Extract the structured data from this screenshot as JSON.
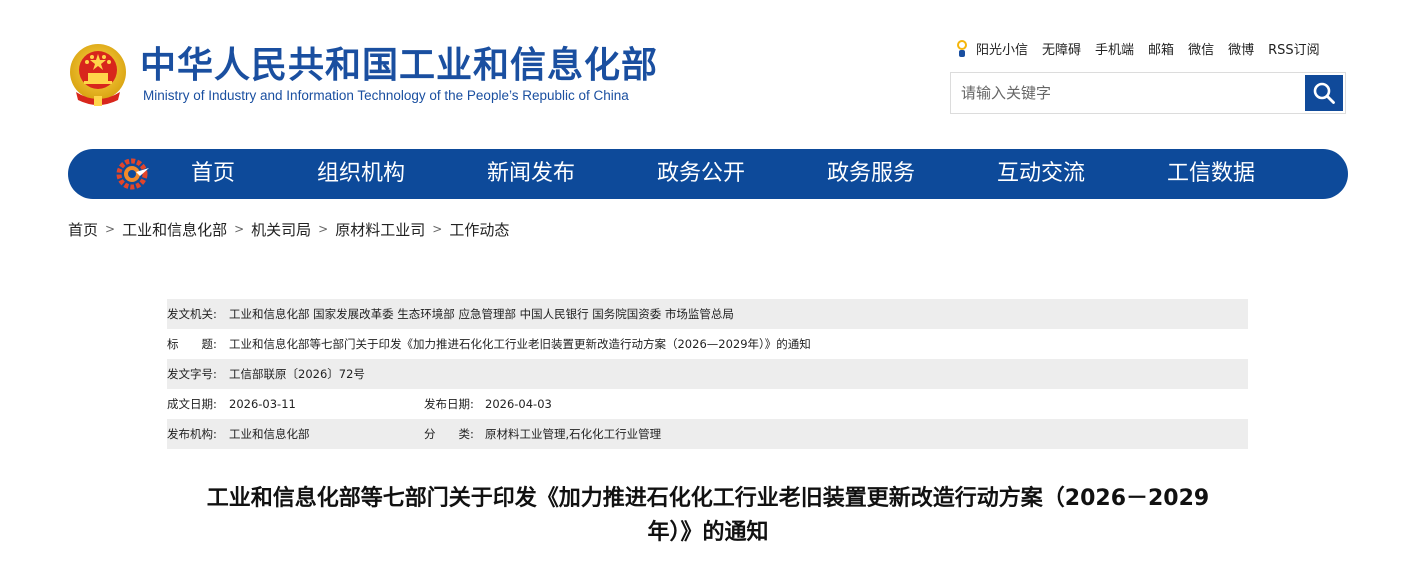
{
  "header": {
    "title": "中华人民共和国工业和信息化部",
    "subtitle": "Ministry of Industry and Information Technology of the People’s Republic of China",
    "emblem_icon": "national-emblem-icon",
    "brand_color": "#1a4fa0",
    "top_links": [
      "阳光小信",
      "无障碍",
      "手机端",
      "邮箱",
      "微信",
      "微博",
      "RSS订阅"
    ],
    "search": {
      "placeholder": "请输入关键字",
      "value": "",
      "button_icon": "search-icon"
    }
  },
  "nav": {
    "bg_color": "#0d4a9a",
    "logo_icon": "ministry-gear-logo-icon",
    "items": [
      "首页",
      "组织机构",
      "新闻发布",
      "政务公开",
      "政务服务",
      "互动交流",
      "工信数据"
    ]
  },
  "breadcrumb": {
    "items": [
      "首页",
      "工业和信息化部",
      "机关司局",
      "原材料工业司",
      "工作动态"
    ],
    "separator": ">"
  },
  "info": {
    "issuer_label": "发文机关:",
    "issuer_value": "工业和信息化部 国家发展改革委 生态环境部 应急管理部 中国人民银行 国务院国资委 市场监管总局",
    "title_label": "标　　题:",
    "title_value": "工业和信息化部等七部门关于印发《加力推进石化化工行业老旧装置更新改造行动方案（2026—2029年）》的通知",
    "docno_label": "发文字号:",
    "docno_value": "工信部联原〔2026〕72号",
    "created_label": "成文日期:",
    "created_value": "2026-03-11",
    "published_label": "发布日期:",
    "published_value": "2026-04-03",
    "org_label": "发布机构:",
    "org_value": "工业和信息化部",
    "category_label": "分　　类:",
    "category_value": "原材料工业管理,石化化工行业管理"
  },
  "article": {
    "title_line1": "工业和信息化部等七部门关于印发《加力推进石化化工行业老旧装置更新改造行动方案（2026－2029",
    "title_line2": "年）》的通知"
  }
}
